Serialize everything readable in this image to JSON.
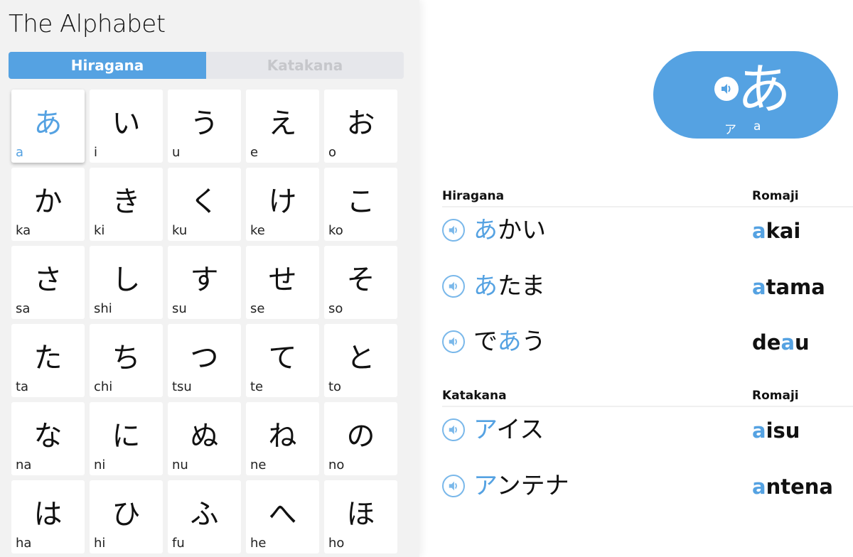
{
  "left_panel": {
    "title": "The Alphabet",
    "tabs": [
      {
        "label": "Hiragana",
        "active": true
      },
      {
        "label": "Katakana",
        "active": false
      }
    ],
    "characters": [
      {
        "kana": "あ",
        "romaji": "a",
        "selected": true
      },
      {
        "kana": "い",
        "romaji": "i"
      },
      {
        "kana": "う",
        "romaji": "u"
      },
      {
        "kana": "え",
        "romaji": "e"
      },
      {
        "kana": "お",
        "romaji": "o"
      },
      {
        "kana": "か",
        "romaji": "ka"
      },
      {
        "kana": "き",
        "romaji": "ki"
      },
      {
        "kana": "く",
        "romaji": "ku"
      },
      {
        "kana": "け",
        "romaji": "ke"
      },
      {
        "kana": "こ",
        "romaji": "ko"
      },
      {
        "kana": "さ",
        "romaji": "sa"
      },
      {
        "kana": "し",
        "romaji": "shi"
      },
      {
        "kana": "す",
        "romaji": "su"
      },
      {
        "kana": "せ",
        "romaji": "se"
      },
      {
        "kana": "そ",
        "romaji": "so"
      },
      {
        "kana": "た",
        "romaji": "ta"
      },
      {
        "kana": "ち",
        "romaji": "chi"
      },
      {
        "kana": "つ",
        "romaji": "tsu"
      },
      {
        "kana": "て",
        "romaji": "te"
      },
      {
        "kana": "と",
        "romaji": "to"
      },
      {
        "kana": "な",
        "romaji": "na"
      },
      {
        "kana": "に",
        "romaji": "ni"
      },
      {
        "kana": "ぬ",
        "romaji": "nu"
      },
      {
        "kana": "ね",
        "romaji": "ne"
      },
      {
        "kana": "の",
        "romaji": "no"
      },
      {
        "kana": "は",
        "romaji": "ha"
      },
      {
        "kana": "ひ",
        "romaji": "hi"
      },
      {
        "kana": "ふ",
        "romaji": "fu"
      },
      {
        "kana": "へ",
        "romaji": "he"
      },
      {
        "kana": "ほ",
        "romaji": "ho"
      }
    ]
  },
  "detail": {
    "selected_kana": "あ",
    "katakana": "ア",
    "romaji": "a",
    "sound_icon": "speaker-icon",
    "accent_color": "#55a2e2",
    "sections": [
      {
        "header": "Hiragana",
        "romaji_header": "Romaji",
        "words": [
          {
            "parts": [
              {
                "t": "あ",
                "hl": true
              },
              {
                "t": "かい",
                "hl": false
              }
            ],
            "romaji": [
              {
                "t": "a",
                "hl": true
              },
              {
                "t": "kai",
                "hl": false
              }
            ]
          },
          {
            "parts": [
              {
                "t": "あ",
                "hl": true
              },
              {
                "t": "たま",
                "hl": false
              }
            ],
            "romaji": [
              {
                "t": "a",
                "hl": true
              },
              {
                "t": "tama",
                "hl": false
              }
            ]
          },
          {
            "parts": [
              {
                "t": "で",
                "hl": false
              },
              {
                "t": "あ",
                "hl": true
              },
              {
                "t": "う",
                "hl": false
              }
            ],
            "romaji": [
              {
                "t": "de",
                "hl": false
              },
              {
                "t": "a",
                "hl": true
              },
              {
                "t": "u",
                "hl": false
              }
            ]
          }
        ]
      },
      {
        "header": "Katakana",
        "romaji_header": "Romaji",
        "words": [
          {
            "parts": [
              {
                "t": "ア",
                "hl": true
              },
              {
                "t": "イス",
                "hl": false
              }
            ],
            "romaji": [
              {
                "t": "a",
                "hl": true
              },
              {
                "t": "isu",
                "hl": false
              }
            ]
          },
          {
            "parts": [
              {
                "t": "ア",
                "hl": true
              },
              {
                "t": "ンテナ",
                "hl": false
              }
            ],
            "romaji": [
              {
                "t": "a",
                "hl": true
              },
              {
                "t": "ntena",
                "hl": false
              }
            ]
          }
        ]
      }
    ]
  }
}
